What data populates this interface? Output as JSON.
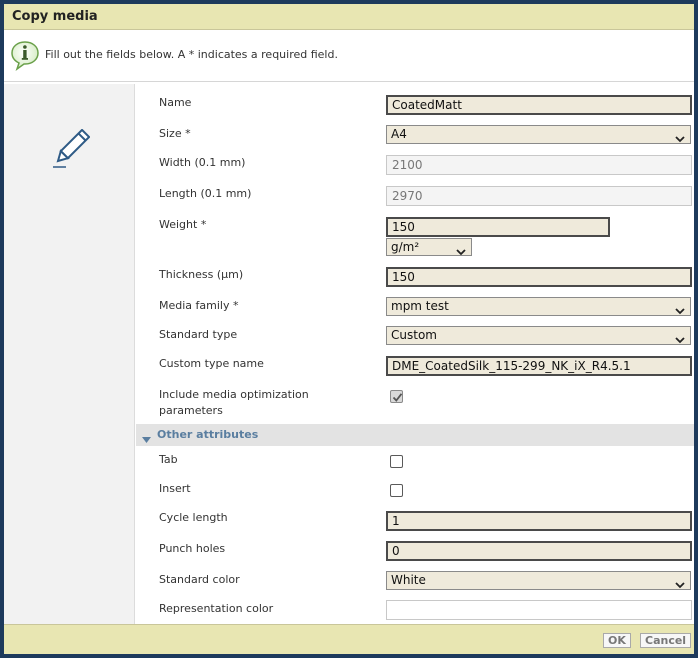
{
  "dialog": {
    "title": "Copy media"
  },
  "info": {
    "text": "Fill out the fields below. A * indicates a required field.",
    "icon": "info-bubble-icon"
  },
  "form": {
    "name": {
      "label": "Name",
      "value": "CoatedMatt"
    },
    "size": {
      "label": "Size *",
      "value": "A4"
    },
    "width": {
      "label": "Width (0.1 mm)",
      "value": "2100"
    },
    "length": {
      "label": "Length (0.1 mm)",
      "value": "2970"
    },
    "weight": {
      "label": "Weight *",
      "value": "150",
      "unit": "g/m²"
    },
    "thickness": {
      "label": "Thickness (µm)",
      "value": "150"
    },
    "media_family": {
      "label": "Media family *",
      "value": "mpm test"
    },
    "standard_type": {
      "label": "Standard type",
      "value": "Custom"
    },
    "custom_type_name": {
      "label": "Custom type name",
      "value": "DME_CoatedSilk_115-299_NK_iX_R4.5.1"
    },
    "include_optimization": {
      "label_line1": "Include media optimization",
      "label_line2": "parameters",
      "checked": true
    }
  },
  "other_attributes": {
    "header": "Other attributes",
    "tab": {
      "label": "Tab",
      "checked": false
    },
    "insert": {
      "label": "Insert",
      "checked": false
    },
    "cycle_length": {
      "label": "Cycle length",
      "value": "1"
    },
    "punch_holes": {
      "label": "Punch holes",
      "value": "0"
    },
    "standard_color": {
      "label": "Standard color",
      "value": "White"
    },
    "representation_color": {
      "label": "Representation color",
      "value": ""
    }
  },
  "footer": {
    "ok_label": "OK",
    "cancel_label": "Cancel"
  },
  "colors": {
    "title_bar": "#e8e6b2",
    "border": "#1d3a5c",
    "field_bg": "#efeadb",
    "section_text": "#5a7ea0"
  }
}
